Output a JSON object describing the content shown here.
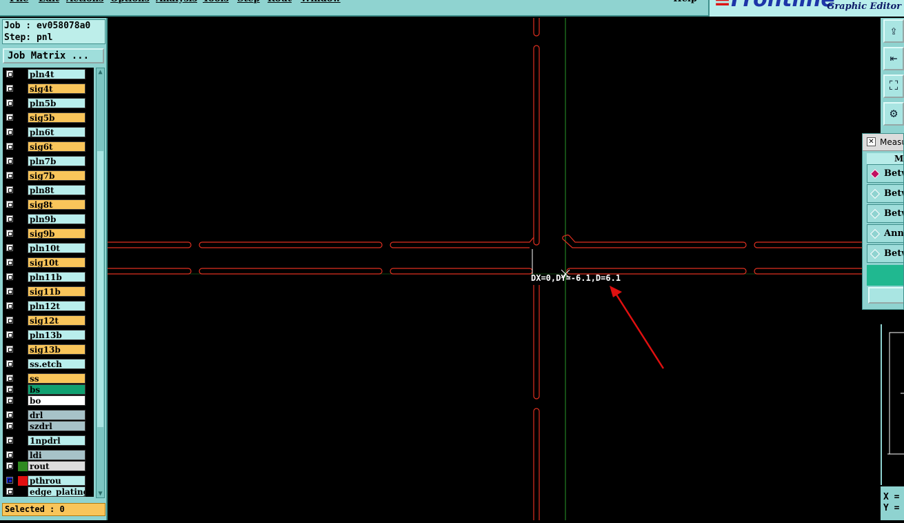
{
  "menubar": {
    "items": [
      "File",
      "Edit",
      "Actions",
      "Options",
      "Analysis",
      "Tools",
      "Step",
      "Rout",
      "Window"
    ],
    "help": "Help"
  },
  "brand": {
    "logo": "Frontline",
    "subtitle": "Graphic Editor"
  },
  "job": {
    "job_line": "Job : ev058078a0",
    "step_line": "Step: pnl"
  },
  "job_matrix_label": "Job Matrix ...",
  "layers": [
    {
      "name": "pln4t",
      "color": "#b9eeec"
    },
    {
      "name": "sig4t",
      "color": "#f9c55a"
    },
    {
      "name": "pln5b",
      "color": "#b9eeec"
    },
    {
      "name": "sig5b",
      "color": "#f9c55a"
    },
    {
      "name": "pln6t",
      "color": "#b9eeec"
    },
    {
      "name": "sig6t",
      "color": "#f9c55a"
    },
    {
      "name": "pln7b",
      "color": "#b9eeec"
    },
    {
      "name": "sig7b",
      "color": "#f9c55a"
    },
    {
      "name": "pln8t",
      "color": "#b9eeec"
    },
    {
      "name": "sig8t",
      "color": "#f9c55a"
    },
    {
      "name": "pln9b",
      "color": "#b9eeec"
    },
    {
      "name": "sig9b",
      "color": "#f9c55a"
    },
    {
      "name": "pln10t",
      "color": "#b9eeec"
    },
    {
      "name": "sig10t",
      "color": "#f9c55a"
    },
    {
      "name": "pln11b",
      "color": "#b9eeec"
    },
    {
      "name": "sig11b",
      "color": "#f9c55a"
    },
    {
      "name": "pln12t",
      "color": "#b9eeec"
    },
    {
      "name": "sig12t",
      "color": "#f9c55a"
    },
    {
      "name": "pln13b",
      "color": "#b9eeec"
    },
    {
      "name": "sig13b",
      "color": "#f9c55a"
    },
    {
      "name": "ss.etch",
      "color": "#b9eeec"
    },
    {
      "name": "ss",
      "color": "#f9c55a"
    },
    {
      "name": "bs",
      "color": "#10a070"
    },
    {
      "name": "bo",
      "color": "#ffffff"
    },
    {
      "name": "drl",
      "color": "#a7c2c8"
    },
    {
      "name": "szdrl",
      "color": "#a7c2c8"
    },
    {
      "name": "1npdrl",
      "color": "#b9eeec"
    },
    {
      "name": "ldi",
      "color": "#a7c2c8"
    },
    {
      "name": "rout",
      "color": "#dddddd",
      "swatch": "#2f8a20"
    },
    {
      "name": "pthrou",
      "color": "#b9eeec",
      "swatch": "#e01010",
      "check": "#1020c0"
    },
    {
      "name": "edge_plating",
      "color": "#b9eeec"
    }
  ],
  "selected_label": "Selected : 0",
  "measurement_readout": "DX=0,DY=-6.1,D=6.1",
  "measure_window": {
    "title": "Measu",
    "header": "Me",
    "options": [
      "Betw",
      "Betw",
      "Betw",
      "Annu",
      "Betw"
    ],
    "selected_index": 0
  },
  "coords": {
    "x_label": "X =",
    "y_label": "Y ="
  },
  "colors": {
    "trace": "#e03020",
    "grid_line": "#2a9a2a",
    "annotation_arrow": "#e01010"
  }
}
